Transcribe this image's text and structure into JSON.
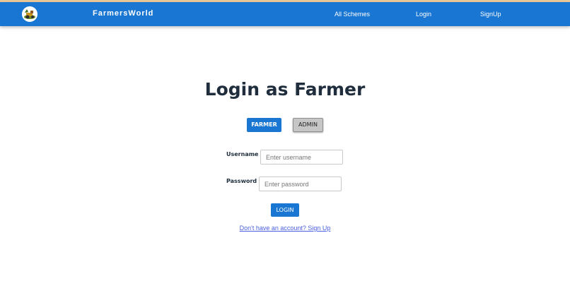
{
  "navbar": {
    "logo_icon": "farmer-tractor-logo-icon",
    "brand": "FarmersWorld",
    "links": [
      "All Schemes",
      "Login",
      "SignUp"
    ],
    "color": "#1976d2"
  },
  "main": {
    "title": "Login as Farmer",
    "roles": {
      "farmer": "FARMER",
      "admin": "ADMIN",
      "selected": "FARMER"
    },
    "username": {
      "label": "Username",
      "placeholder": "Enter username",
      "value": ""
    },
    "password": {
      "label": "Password",
      "placeholder": "Enter password",
      "value": ""
    },
    "login_button": "LOGIN",
    "signup_link": "Don't have an account? Sign Up"
  },
  "colors": {
    "primary": "#1976d2",
    "title": "#1f2d3d",
    "link": "#4a5fe0",
    "admin_button": "#c6c6c6"
  }
}
